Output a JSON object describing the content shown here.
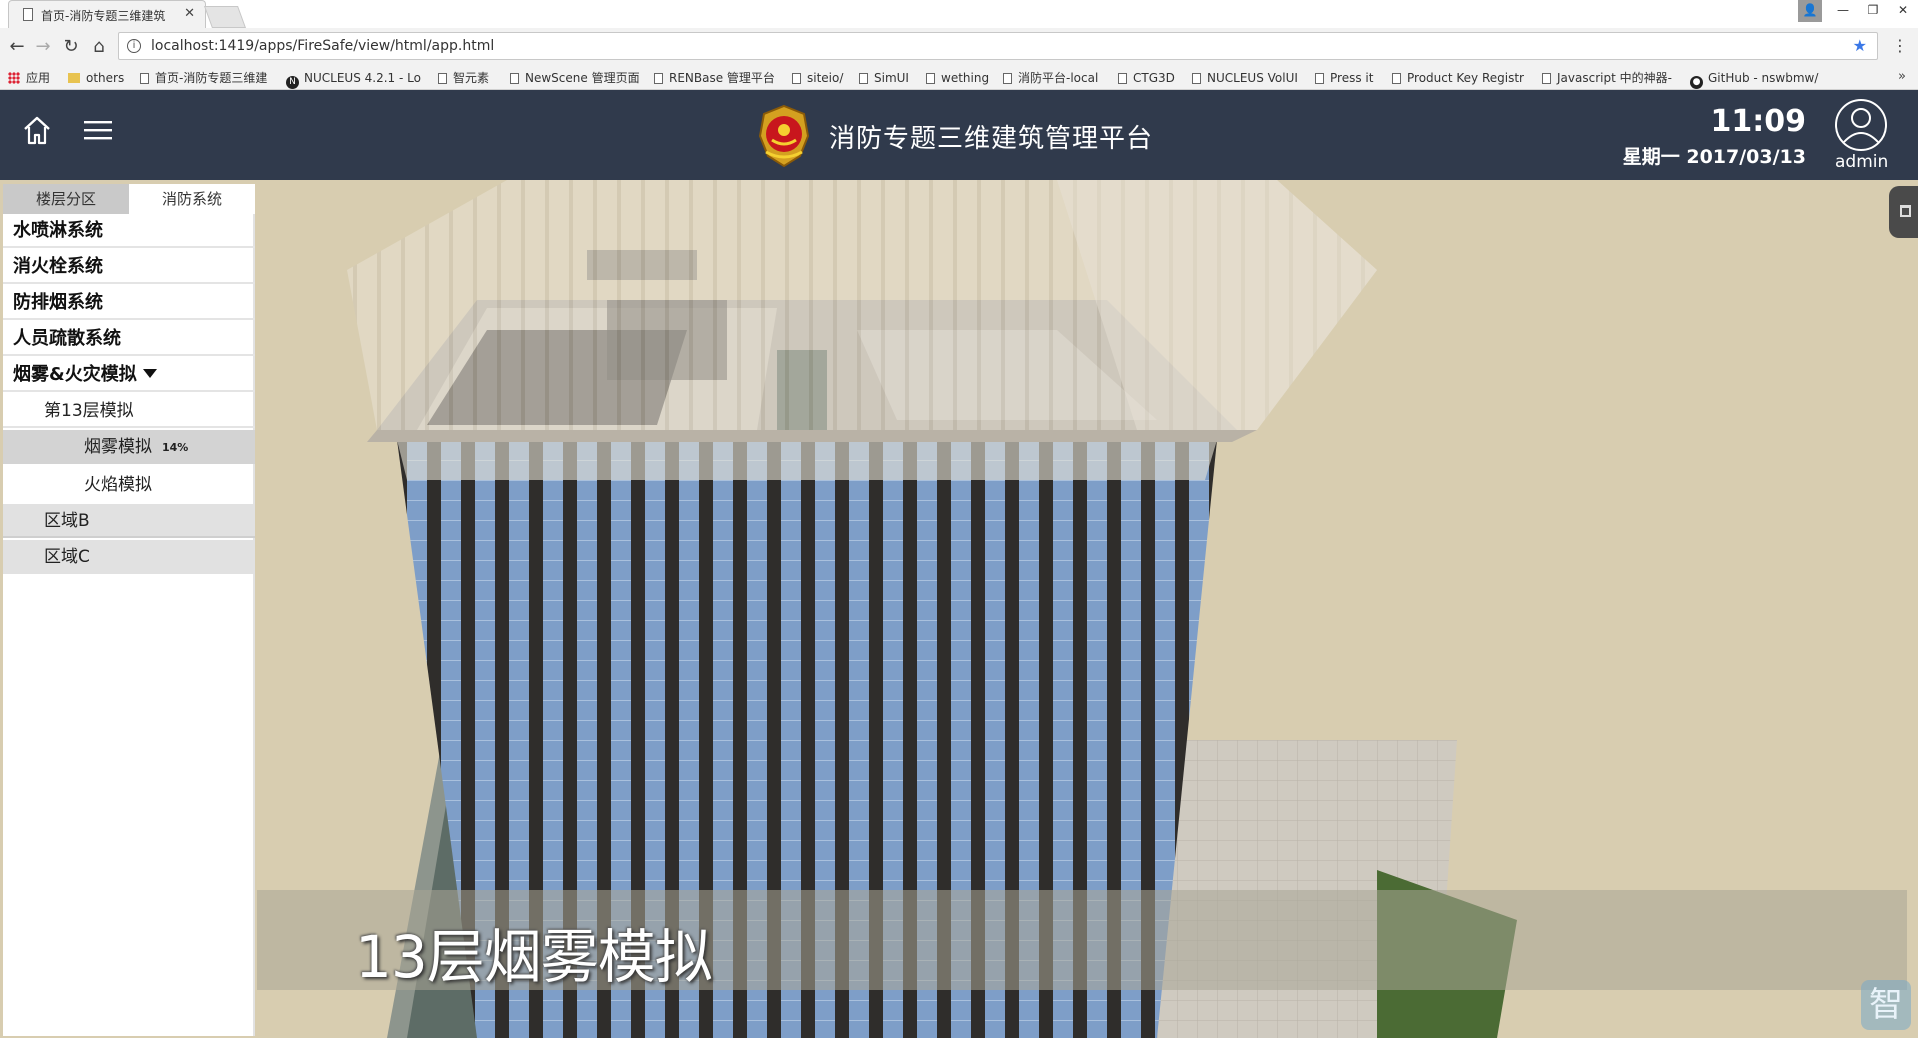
{
  "browser": {
    "tab_title": "首页-消防专题三维建筑",
    "url": "localhost:1419/apps/FireSafe/view/html/app.html",
    "bookmarks": [
      {
        "label": "应用",
        "icon": "apps-grid-icon"
      },
      {
        "label": "others",
        "icon": "folder-icon"
      },
      {
        "label": "首页-消防专题三维建",
        "icon": "page-icon"
      },
      {
        "label": "NUCLEUS 4.2.1 - Lo",
        "icon": "nucleus-icon"
      },
      {
        "label": "智元素",
        "icon": "page-icon"
      },
      {
        "label": "NewScene 管理页面",
        "icon": "page-icon"
      },
      {
        "label": "RENBase 管理平台",
        "icon": "page-icon"
      },
      {
        "label": "siteio/",
        "icon": "page-icon"
      },
      {
        "label": "SimUI",
        "icon": "page-icon"
      },
      {
        "label": "wething",
        "icon": "page-icon"
      },
      {
        "label": "消防平台-local",
        "icon": "page-icon"
      },
      {
        "label": "CTG3D",
        "icon": "page-icon"
      },
      {
        "label": "NUCLEUS VolUI",
        "icon": "page-icon"
      },
      {
        "label": "Press it",
        "icon": "page-icon"
      },
      {
        "label": "Product Key Registr",
        "icon": "page-icon"
      },
      {
        "label": "Javascript 中的神器-",
        "icon": "page-icon"
      },
      {
        "label": "GitHub - nswbmw/",
        "icon": "github-icon"
      }
    ],
    "more": "»"
  },
  "header": {
    "title": "消防专题三维建筑管理平台",
    "time": "11:09",
    "date": "星期一 2017/03/13",
    "user": "admin"
  },
  "sidebar": {
    "tabs": [
      {
        "label": "楼层分区",
        "active": false
      },
      {
        "label": "消防系统",
        "active": true
      }
    ],
    "systems": [
      {
        "label": "水喷淋系统"
      },
      {
        "label": "消火栓系统"
      },
      {
        "label": "防排烟系统"
      },
      {
        "label": "人员疏散系统"
      },
      {
        "label": "烟雾&火灾模拟"
      }
    ],
    "floor_item": "第13层模拟",
    "smoke_item": "烟雾模拟",
    "smoke_progress": "14%",
    "fire_item": "火焰模拟",
    "zones": [
      {
        "label": "区域B"
      },
      {
        "label": "区域C"
      }
    ]
  },
  "viewport": {
    "caption": "13层烟雾模拟",
    "watermark": "智"
  }
}
